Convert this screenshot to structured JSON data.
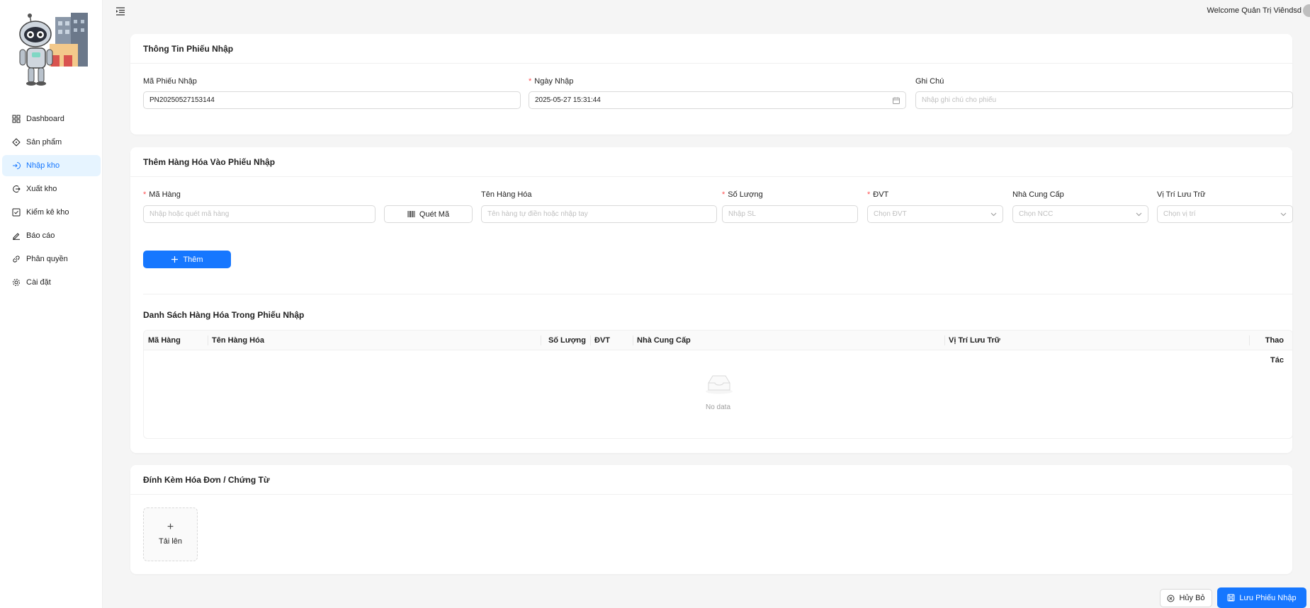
{
  "header": {
    "welcome": "Welcome Quản Trị Viêndsd"
  },
  "sidebar": {
    "items": [
      {
        "label": "Dashboard",
        "icon": "dashboard-icon"
      },
      {
        "label": "Sản phẩm",
        "icon": "product-icon"
      },
      {
        "label": "Nhập kho",
        "icon": "import-icon",
        "active": true
      },
      {
        "label": "Xuất kho",
        "icon": "export-icon"
      },
      {
        "label": "Kiểm kê kho",
        "icon": "checkbox-icon"
      },
      {
        "label": "Báo cáo",
        "icon": "edit-icon"
      },
      {
        "label": "Phân quyền",
        "icon": "link-icon"
      },
      {
        "label": "Cài đặt",
        "icon": "gear-icon"
      }
    ]
  },
  "receipt_info": {
    "title": "Thông Tin Phiếu Nhập",
    "code_label": "Mã Phiếu Nhập",
    "code_value": "PN20250527153144",
    "date_label": "Ngày Nhập",
    "date_value": "2025-05-27 15:31:44",
    "note_label": "Ghi Chú",
    "note_placeholder": "Nhập ghi chú cho phiếu"
  },
  "add_goods": {
    "title": "Thêm Hàng Hóa Vào Phiếu Nhập",
    "sku_label": "Mã Hàng",
    "sku_placeholder": "Nhập hoặc quét mã hàng",
    "scan_button": "Quét Mã",
    "name_label": "Tên Hàng Hóa",
    "name_placeholder": "Tên hàng tự điền hoặc nhập tay",
    "qty_label": "Số Lượng",
    "qty_placeholder": "Nhập SL",
    "unit_label": "ĐVT",
    "unit_placeholder": "Chọn ĐVT",
    "supplier_label": "Nhà Cung Cấp",
    "supplier_placeholder": "Chọn NCC",
    "location_label": "Vị Trí Lưu Trữ",
    "location_placeholder": "Chọn vị trí",
    "add_button": "Thêm"
  },
  "goods_list": {
    "title": "Danh Sách Hàng Hóa Trong Phiếu Nhập",
    "columns": [
      "Mã Hàng",
      "Tên Hàng Hóa",
      "Số Lượng",
      "ĐVT",
      "Nhà Cung Cấp",
      "Vị Trí Lưu Trữ",
      "Thao Tác"
    ],
    "empty_text": "No data"
  },
  "attachments": {
    "title": "Đính Kèm Hóa Đơn / Chứng Từ",
    "upload_label": "Tải lên"
  },
  "footer": {
    "cancel_button": "Hủy Bỏ",
    "save_button": "Lưu Phiếu Nhập"
  },
  "colors": {
    "primary": "#1677ff",
    "active_bg": "#e6f4ff",
    "required": "#ff4d4f"
  }
}
